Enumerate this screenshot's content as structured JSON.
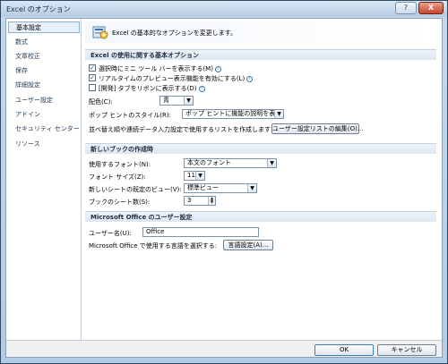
{
  "window": {
    "title": "Excel のオプション",
    "help_label": "?",
    "close_label": "X"
  },
  "nav": {
    "items": [
      {
        "label": "基本設定",
        "selected": true
      },
      {
        "label": "数式"
      },
      {
        "label": "文章校正"
      },
      {
        "label": "保存"
      },
      {
        "label": "詳細設定"
      },
      {
        "label": "ユーザー設定"
      },
      {
        "label": "アドイン"
      },
      {
        "label": "セキュリティ センター"
      },
      {
        "label": "リソース"
      }
    ]
  },
  "banner": {
    "text": "Excel の基本的なオプションを変更します。"
  },
  "sections": {
    "top": {
      "title": "Excel の使用に関する基本オプション",
      "check_minitoolbar": "選択時にミニ ツール バーを表示する(M)",
      "check_livepreview": "リアルタイムのプレビュー表示機能を有効にする(L)",
      "check_developer": "[開発] タブをリボンに表示する(D)",
      "color_label": "配色(C):",
      "color_value": "青",
      "tooltip_label": "ポップ ヒントのスタイル(R):",
      "tooltip_value": "ポップ ヒントに機能の説明を表示する",
      "customlist_label": "並べ替え順や連続データ入力設定で使用するリストを作成します:",
      "customlist_button": "ユーザー設定リストの編集(O)..."
    },
    "newbook": {
      "title": "新しいブックの作成時",
      "font_label": "使用するフォント(N):",
      "font_value": "本文のフォント",
      "size_label": "フォント サイズ(Z):",
      "size_value": "11",
      "view_label": "新しいシートの既定のビュー(V):",
      "view_value": "標準ビュー",
      "sheets_label": "ブックのシート数(S):",
      "sheets_value": "3"
    },
    "office": {
      "title": "Microsoft Office のユーザー設定",
      "username_label": "ユーザー名(U):",
      "username_value": "Office",
      "language_label": "Microsoft Office で使用する言語を選択する:",
      "language_button": "言語設定(A)..."
    }
  },
  "footer": {
    "ok_label": "OK",
    "cancel_label": "キャンセル"
  }
}
